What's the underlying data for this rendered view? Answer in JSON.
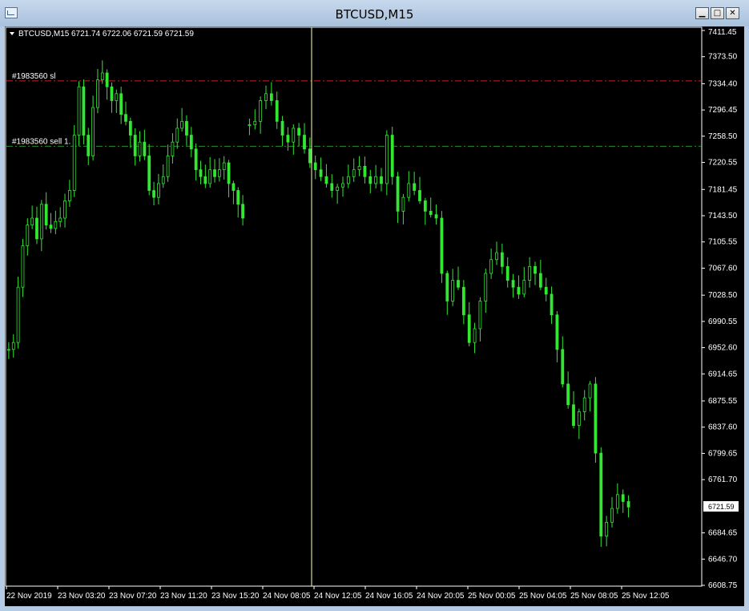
{
  "window": {
    "title": "BTCUSD,M15",
    "buttons": [
      "minimize",
      "maximize",
      "close"
    ]
  },
  "chart_header": {
    "symbol": "BTCUSD,M15",
    "ohlc": "6721.74 6722.06 6721.59 6721.59"
  },
  "order_lines": [
    {
      "label": "#1983560 sl",
      "price": 7338.5,
      "color": "#cc2222"
    },
    {
      "label": "#1983560 sell 1.",
      "price": 7244.0,
      "color": "#2a8a2a"
    }
  ],
  "current_price_label": "6721.59",
  "colors": {
    "background": "#000000",
    "candle": "#32e632",
    "axis": "#ffffff",
    "crosshair": "#ffffc0"
  },
  "chart_data": {
    "type": "candlestick",
    "ylim": [
      6608.75,
      7411.45
    ],
    "y_ticks": [
      "7411.45",
      "7373.50",
      "7334.40",
      "7296.45",
      "7258.50",
      "7220.55",
      "7181.45",
      "7143.50",
      "7105.55",
      "7067.60",
      "7028.50",
      "6990.55",
      "6952.60",
      "6914.65",
      "6875.55",
      "6837.60",
      "6799.65",
      "6761.70",
      "6721.59",
      "6684.65",
      "6646.70",
      "6608.75"
    ],
    "x_labels": [
      "22 Nov 2019",
      "23 Nov 03:20",
      "23 Nov 07:20",
      "23 Nov 11:20",
      "23 Nov 15:20",
      "24 Nov 08:05",
      "24 Nov 12:05",
      "24 Nov 16:05",
      "24 Nov 20:05",
      "25 Nov 00:05",
      "25 Nov 04:05",
      "25 Nov 08:05",
      "25 Nov 12:05"
    ],
    "close_series": [
      6950,
      6960,
      7040,
      7100,
      7130,
      7140,
      7110,
      7160,
      7130,
      7125,
      7135,
      7140,
      7165,
      7180,
      7260,
      7330,
      7260,
      7230,
      7300,
      7340,
      7350,
      7330,
      7310,
      7320,
      7290,
      7280,
      7260,
      7230,
      7250,
      7230,
      7180,
      7170,
      7190,
      7200,
      7230,
      7250,
      7270,
      7280,
      7260,
      7240,
      7210,
      7200,
      7190,
      7210,
      7200,
      7210,
      7220,
      7190,
      7180,
      7160,
      7140,
      7275,
      7280,
      7310,
      7320,
      7310,
      7280,
      7260,
      7250,
      7270,
      7260,
      7240,
      7220,
      7210,
      7200,
      7190,
      7180,
      7185,
      7190,
      7200,
      7210,
      7215,
      7200,
      7190,
      7200,
      7190,
      7260,
      7200,
      7150,
      7170,
      7190,
      7180,
      7165,
      7150,
      7145,
      7140,
      7060,
      7020,
      7050,
      7040,
      7000,
      6960,
      6980,
      7020,
      7060,
      7080,
      7090,
      7070,
      7050,
      7040,
      7030,
      7050,
      7070,
      7060,
      7040,
      7030,
      7000,
      6950,
      6900,
      6870,
      6840,
      6860,
      6880,
      6900,
      6800,
      6680,
      6700,
      6720,
      6740,
      6730,
      6722
    ]
  }
}
